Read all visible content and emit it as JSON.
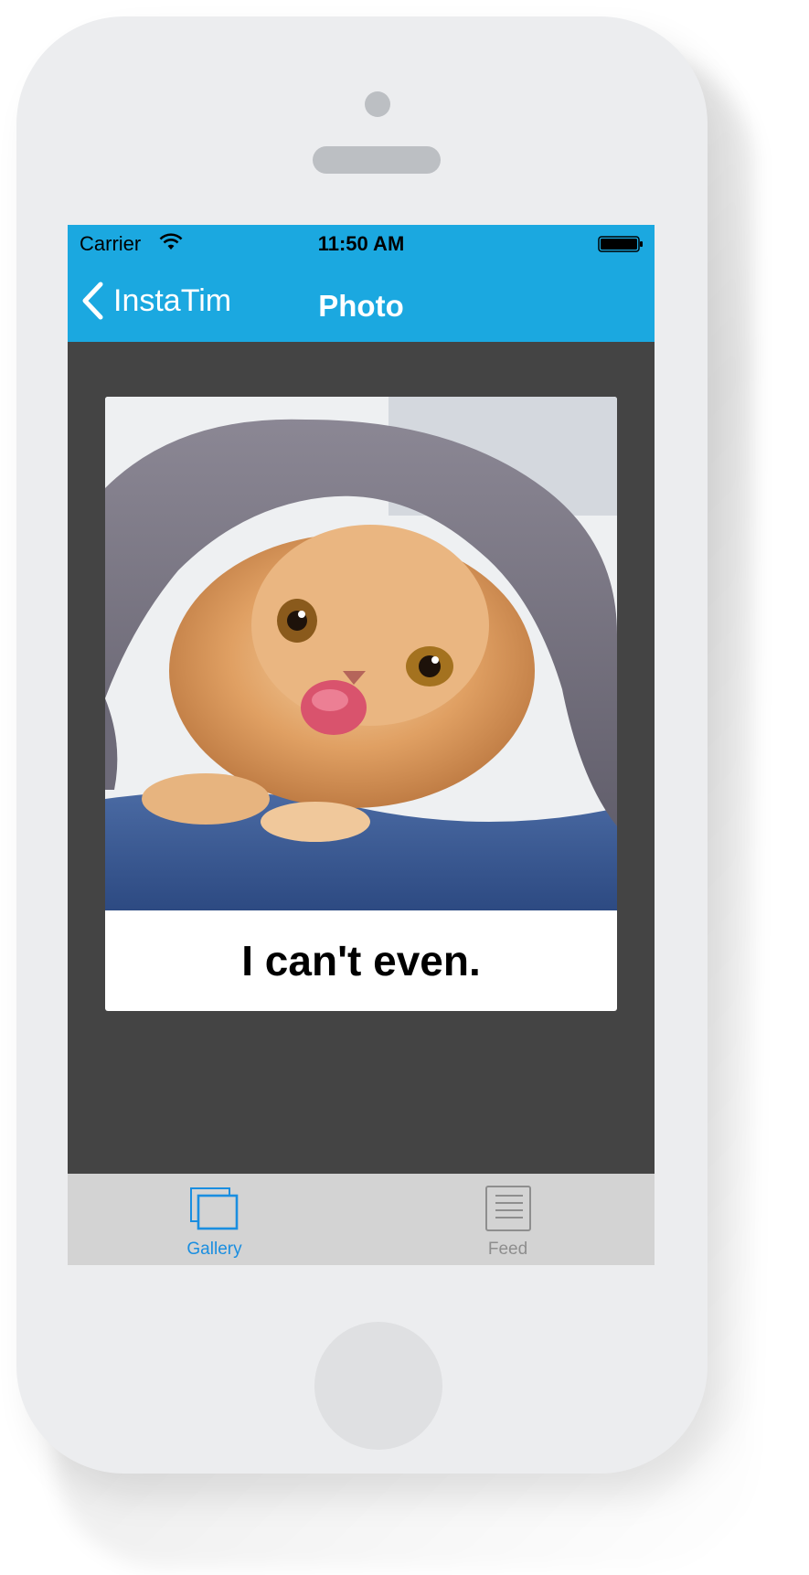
{
  "status_bar": {
    "carrier": "Carrier",
    "time": "11:50 AM",
    "icons": [
      "wifi-icon",
      "battery-icon"
    ]
  },
  "nav_bar": {
    "back_label": "InstaTim",
    "title": "Photo",
    "background_color": "#1ba8e0"
  },
  "photo_card": {
    "image_description_icon": "cat-photo",
    "caption": "I can't even."
  },
  "tab_bar": {
    "tabs": [
      {
        "label": "Gallery",
        "icon": "gallery-icon",
        "selected": true,
        "color": "#1a8ee0"
      },
      {
        "label": "Feed",
        "icon": "feed-icon",
        "selected": false,
        "color": "#8e8e8e"
      }
    ]
  }
}
